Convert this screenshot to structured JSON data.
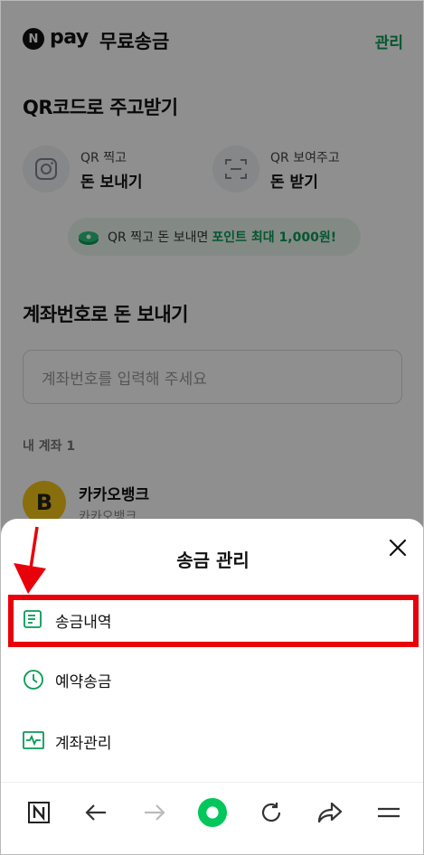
{
  "header": {
    "logo_letter": "N",
    "brand": "pay",
    "title": "무료송금",
    "manage_link": "관리"
  },
  "qr_section": {
    "title": "QR코드로 주고받기",
    "send": {
      "small": "QR 찍고",
      "big": "돈 보내기",
      "icon": "camera-icon"
    },
    "receive": {
      "small": "QR 보여주고",
      "big": "돈 받기",
      "icon": "scan-frame-icon"
    },
    "promo": {
      "text": "QR 찍고 돈 보내면",
      "highlight": "포인트 최대 1,000원!",
      "icon": "coin-icon"
    }
  },
  "account_section": {
    "title": "계좌번호로 돈 보내기",
    "input_placeholder": "계좌번호를 입력해 주세요",
    "my_accounts_label": "내 계좌 1",
    "accounts": [
      {
        "logo_letter": "B",
        "bank": "카카오뱅크",
        "sub": "카카오뱅크"
      }
    ]
  },
  "sheet": {
    "title": "송금 관리",
    "items": [
      {
        "label": "송금내역",
        "icon": "document-icon",
        "highlighted": true
      },
      {
        "label": "예약송금",
        "icon": "clock-icon"
      },
      {
        "label": "계좌관리",
        "icon": "account-chart-icon"
      }
    ]
  },
  "browser_nav": {
    "buttons": [
      "naver-home-icon",
      "back-arrow-icon",
      "forward-arrow-icon",
      "green-dot-icon",
      "refresh-icon",
      "share-icon",
      "menu-icon"
    ]
  },
  "colors": {
    "accent_green": "#0a9a55",
    "highlight_red": "#e8000b",
    "bank_yellow": "#f5c518"
  }
}
